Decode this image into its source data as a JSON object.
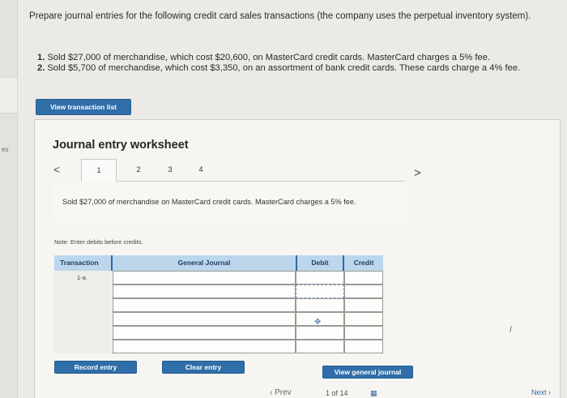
{
  "sidebar": {
    "edge_label": "es"
  },
  "question": {
    "prompt": "Prepare journal entries for the following credit card sales transactions (the company uses the perpetual inventory system).",
    "items": [
      {
        "num": "1.",
        "text": "Sold $27,000 of merchandise, which cost $20,600, on MasterCard credit cards. MasterCard charges a 5% fee."
      },
      {
        "num": "2.",
        "text": "Sold $5,700 of merchandise, which cost $3,350, on an assortment of bank credit cards. These cards charge a 4% fee."
      }
    ]
  },
  "buttons": {
    "view_transactions": "View transaction list",
    "record_entry": "Record entry",
    "clear_entry": "Clear entry",
    "view_general_journal": "View general journal"
  },
  "worksheet": {
    "title": "Journal entry worksheet",
    "prev_chevron": "<",
    "next_chevron": ">",
    "tabs": [
      "1",
      "2",
      "3",
      "4"
    ],
    "active_tab": "1",
    "description": "Sold $27,000 of merchandise on MasterCard credit cards. MasterCard charges a 5% fee.",
    "note": "Note: Enter debits before credits."
  },
  "journal_table": {
    "headers": {
      "transaction": "Transaction",
      "general_journal": "General Journal",
      "debit": "Debit",
      "credit": "Credit"
    },
    "rows": [
      {
        "transaction": "1-a.",
        "account": "",
        "debit": "",
        "credit": ""
      },
      {
        "transaction": "",
        "account": "",
        "debit": "",
        "credit": ""
      },
      {
        "transaction": "",
        "account": "",
        "debit": "",
        "credit": ""
      },
      {
        "transaction": "",
        "account": "",
        "debit": "",
        "credit": ""
      },
      {
        "transaction": "",
        "account": "",
        "debit": "",
        "credit": ""
      },
      {
        "transaction": "",
        "account": "",
        "debit": "",
        "credit": ""
      }
    ]
  },
  "pager": {
    "prev_label": "Prev",
    "count": "1 of 14",
    "next_label": "Next"
  },
  "colors": {
    "accent_blue": "#2f6ea8",
    "header_light_blue": "#bcd6ec"
  },
  "icons": {
    "move": "move-arrows-icon",
    "grid": "grid-icon"
  }
}
